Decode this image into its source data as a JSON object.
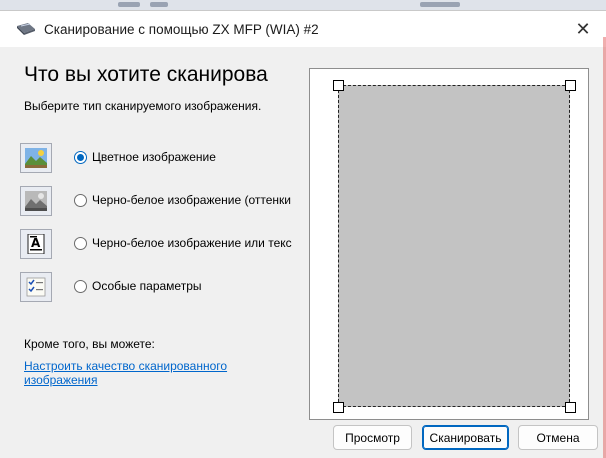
{
  "window": {
    "title": "Сканирование с помощью ZX MFP (WIA) #2",
    "close_glyph": "✕"
  },
  "main": {
    "heading": "Что вы хотите сканирова",
    "subtitle": "Выберите тип сканируемого изображения."
  },
  "options": [
    {
      "label": "Цветное изображение",
      "selected": true,
      "icon": "color-picture-icon"
    },
    {
      "label": "Черно-белое изображение (оттенки",
      "selected": false,
      "icon": "grayscale-picture-icon"
    },
    {
      "label": "Черно-белое изображение или текс",
      "selected": false,
      "icon": "black-white-text-icon"
    },
    {
      "label": "Особые параметры",
      "selected": false,
      "icon": "custom-settings-icon"
    }
  ],
  "also": {
    "label": "Кроме того, вы можете:",
    "link": "Настроить качество сканированного изображения"
  },
  "buttons": {
    "preview": "Просмотр",
    "scan": "Сканировать",
    "cancel": "Отмена"
  },
  "colors": {
    "accent": "#0067c0",
    "link": "#0066cc",
    "scan_area": "#c3c3c3"
  }
}
